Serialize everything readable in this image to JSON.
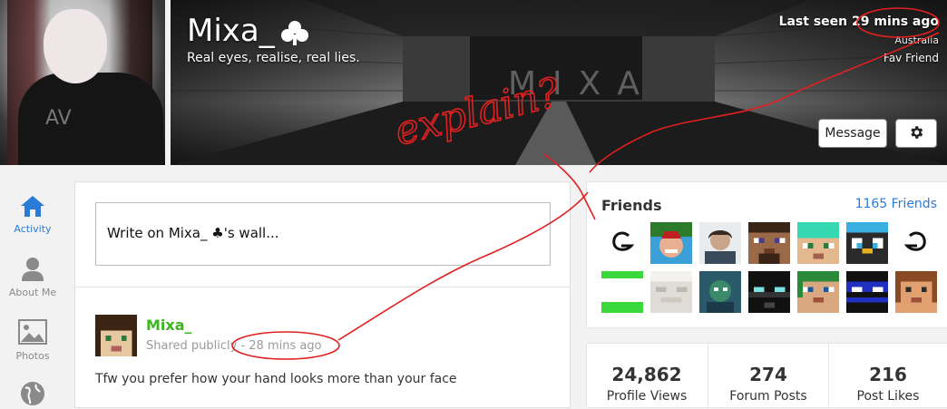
{
  "profile": {
    "name": "Mixa_",
    "tagline": "Real eyes, realise, real lies.",
    "last_seen": "Last seen 29 mins ago",
    "country": "Australia",
    "fav_friend": "Fav Friend",
    "cover_text": "MIXA",
    "shirt_text": "AV"
  },
  "actions": {
    "message_label": "Message",
    "settings_icon": "gear-icon"
  },
  "nav": {
    "items": [
      {
        "label": "Activity",
        "icon": "home-icon",
        "active": true
      },
      {
        "label": "About Me",
        "icon": "person-icon",
        "active": false
      },
      {
        "label": "Photos",
        "icon": "image-icon",
        "active": false
      }
    ]
  },
  "wall": {
    "placeholder": "Write on Mixa_ ♣'s wall..."
  },
  "post": {
    "author": "Mixa_",
    "meta": "Shared publicly - 28 mins ago",
    "text": "Tfw you prefer how your hand looks more than your face"
  },
  "friends": {
    "title": "Friends",
    "count_label": "1165 Friends"
  },
  "stats": [
    {
      "value": "24,862",
      "label": "Profile Views"
    },
    {
      "value": "274",
      "label": "Forum Posts"
    },
    {
      "value": "216",
      "label": "Post Likes"
    }
  ],
  "annotation": {
    "text": "explain?"
  },
  "colors": {
    "accent": "#2a7bd8",
    "author_green": "#3cb521",
    "annotation_red": "#e02020"
  }
}
